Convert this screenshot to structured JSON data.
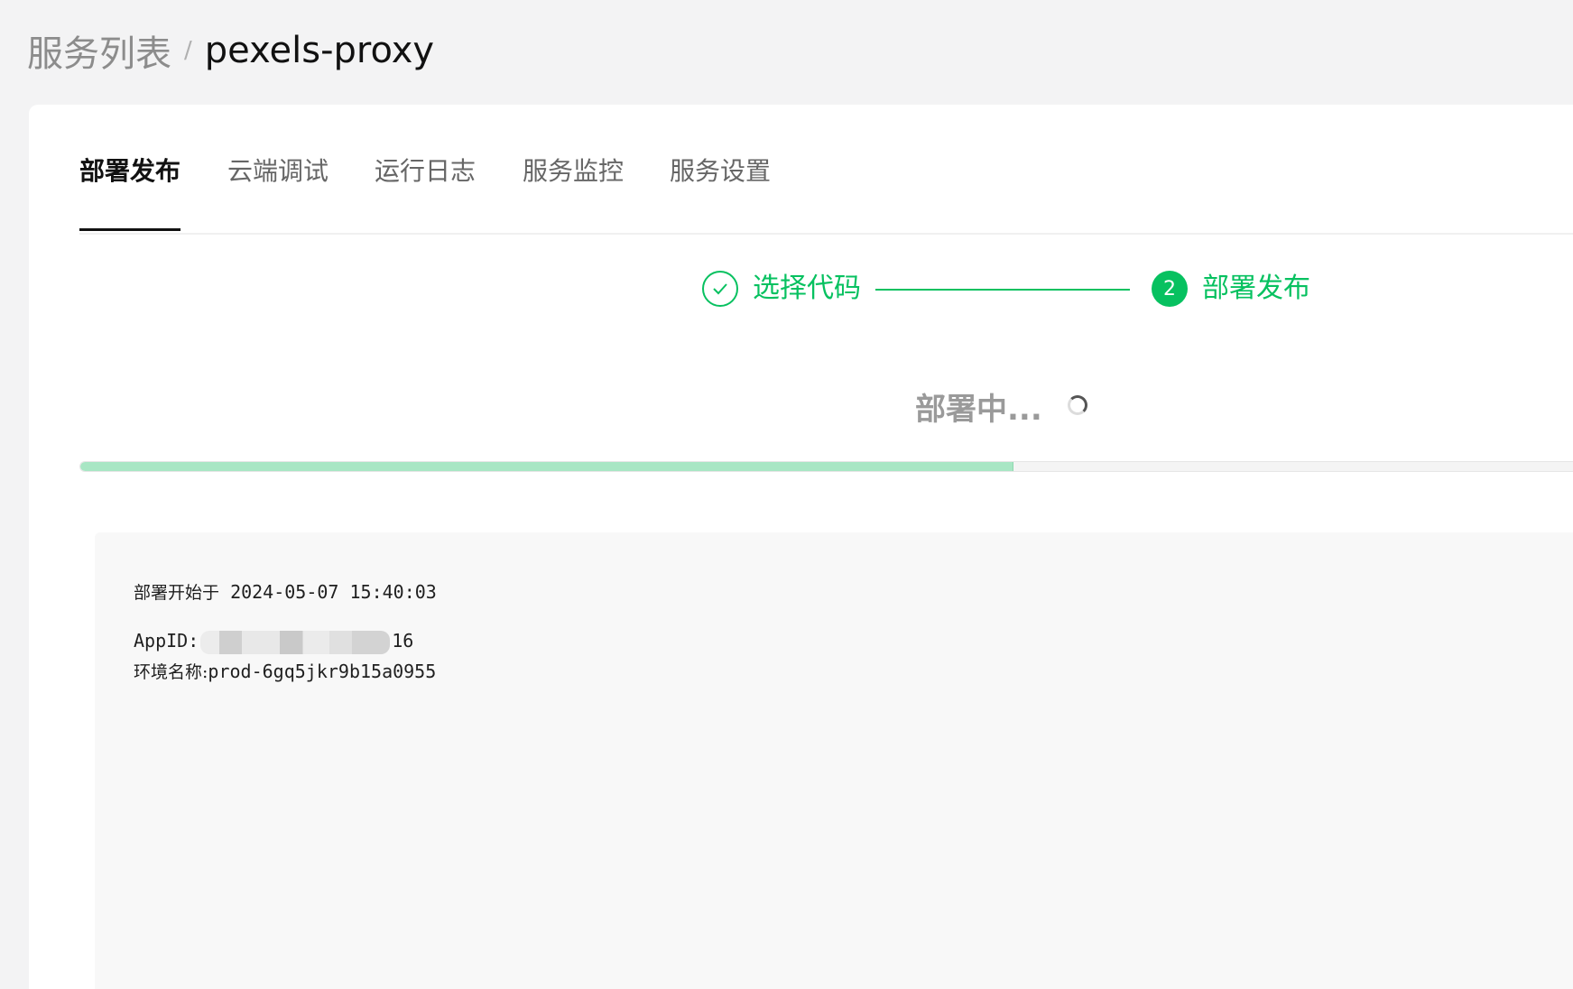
{
  "breadcrumb": {
    "parent": "服务列表",
    "separator": "/",
    "current": "pexels-proxy"
  },
  "tabs": [
    {
      "label": "部署发布",
      "active": true
    },
    {
      "label": "云端调试",
      "active": false
    },
    {
      "label": "运行日志",
      "active": false
    },
    {
      "label": "服务监控",
      "active": false
    },
    {
      "label": "服务设置",
      "active": false
    }
  ],
  "steps": [
    {
      "label": "选择代码",
      "state": "done",
      "icon": "check-icon"
    },
    {
      "label": "部署发布",
      "state": "current",
      "number": "2"
    }
  ],
  "status": {
    "text": "部署中...",
    "icon": "loading-spinner-icon"
  },
  "progress": {
    "percent": 62.5,
    "fill_color": "#a8e6c4"
  },
  "log": {
    "start_label": "部署开始于",
    "start_time": "2024-05-07 15:40:03",
    "appid_label": "AppID:",
    "appid_suffix": "16",
    "env_label": "环境名称:",
    "env_value": "prod-6gq5jkr9b15a0955"
  },
  "colors": {
    "accent": "#07c160",
    "background": "#f3f3f4",
    "card": "#ffffff",
    "log_panel": "#f8f8f8"
  }
}
